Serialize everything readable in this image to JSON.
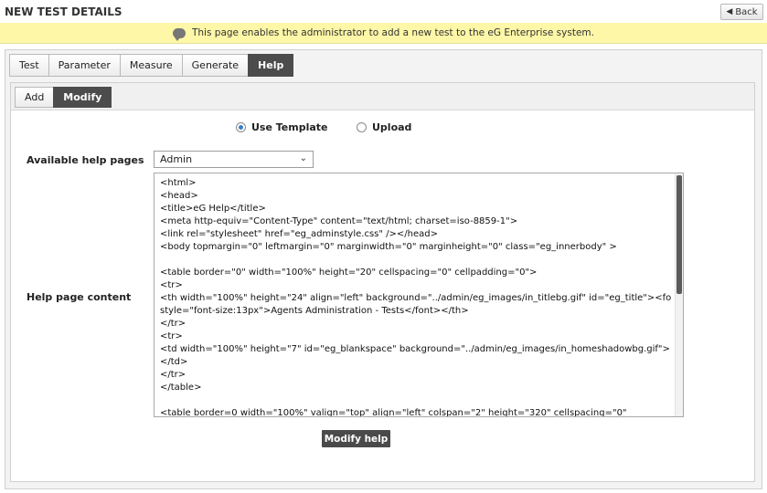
{
  "header": {
    "title": "NEW TEST DETAILS",
    "back_label": "Back",
    "back_icon": "left-arrow-icon"
  },
  "banner": {
    "message": "This page enables the administrator to add a new test to the eG Enterprise system."
  },
  "main_tabs": [
    {
      "label": "Test",
      "active": false
    },
    {
      "label": "Parameter",
      "active": false
    },
    {
      "label": "Measure",
      "active": false
    },
    {
      "label": "Generate",
      "active": false
    },
    {
      "label": "Help",
      "active": true
    }
  ],
  "sub_tabs": [
    {
      "label": "Add",
      "active": false
    },
    {
      "label": "Modify",
      "active": true
    }
  ],
  "source_options": {
    "template_label": "Use Template",
    "upload_label": "Upload",
    "selected": "Use Template"
  },
  "form": {
    "help_pages_label": "Available help pages",
    "help_pages_value": "Admin",
    "content_label": "Help page content",
    "content_lines": [
      "<html>",
      "<head>",
      "<title>eG Help</title>",
      "<meta http-equiv=\"Content-Type\" content=\"text/html; charset=iso-8859-1\">",
      "<link rel=\"stylesheet\" href=\"eg_adminstyle.css\" /></head>",
      "<body topmargin=\"0\" leftmargin=\"0\" marginwidth=\"0\" marginheight=\"0\" class=\"eg_innerbody\" >",
      "",
      "<table border=\"0\" width=\"100%\" height=\"20\" cellspacing=\"0\" cellpadding=\"0\">",
      "<tr>",
      "<th width=\"100%\" height=\"24\" align=\"left\" background=\"../admin/eg_images/in_titlebg.gif\" id=\"eg_title\"><font",
      "style=\"font-size:13px\">Agents Administration - Tests</font></th>",
      "</tr>",
      "<tr>",
      "<td width=\"100%\" height=\"7\" id=\"eg_blankspace\" background=\"../admin/eg_images/in_homeshadowbg.gif\">",
      "</td>",
      "</tr>",
      "</table>",
      "",
      "<table border=0 width=\"100%\" valign=\"top\" align=\"left\" colspan=\"2\" height=\"320\" cellspacing=\"0\""
    ],
    "submit_label": "Modify help"
  },
  "colors": {
    "banner": "#fdf7a7",
    "active_tab": "#4c4c4c",
    "radio_accent": "#3a7fc6"
  }
}
